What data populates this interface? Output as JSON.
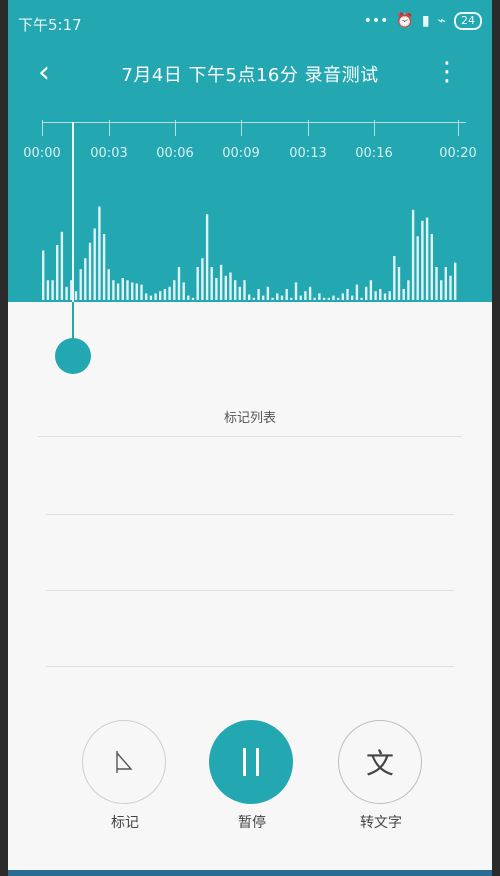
{
  "status_bar": {
    "time": "下午5:17",
    "right_text": "•••",
    "battery": "24"
  },
  "header": {
    "title": "7月4日  下午5点16分   录音测试"
  },
  "timeline": {
    "labels": [
      "00:00",
      "00:03",
      "00:06",
      "00:09",
      "00:13",
      "00:16",
      "00:20"
    ]
  },
  "waveform": {
    "amplitudes": [
      0.45,
      0.18,
      0.18,
      0.5,
      0.62,
      0.12,
      0.18,
      0.08,
      0.28,
      0.38,
      0.52,
      0.65,
      0.85,
      0.6,
      0.28,
      0.18,
      0.15,
      0.2,
      0.18,
      0.16,
      0.15,
      0.14,
      0.06,
      0.04,
      0.06,
      0.08,
      0.1,
      0.12,
      0.18,
      0.3,
      0.16,
      0.04,
      0.02,
      0.3,
      0.38,
      0.78,
      0.3,
      0.2,
      0.32,
      0.22,
      0.25,
      0.18,
      0.12,
      0.18,
      0.05,
      0.02,
      0.1,
      0.04,
      0.12,
      0.02,
      0.06,
      0.04,
      0.1,
      0.02,
      0.16,
      0.04,
      0.08,
      0.12,
      0.02,
      0.06,
      0.02,
      0.02,
      0.04,
      0.02,
      0.06,
      0.1,
      0.04,
      0.14,
      0.02,
      0.12,
      0.18,
      0.08,
      0.1,
      0.06,
      0.08,
      0.4,
      0.3,
      0.1,
      0.18,
      0.82,
      0.58,
      0.72,
      0.75,
      0.6,
      0.3,
      0.18,
      0.3,
      0.22,
      0.34
    ]
  },
  "markers": {
    "title": "标记列表"
  },
  "controls": {
    "mark_label": "标记",
    "pause_label": "暂停",
    "transcribe_label": "转文字",
    "transcribe_icon_text": "文"
  },
  "colors": {
    "accent": "#23a7b1",
    "background": "#f7f7f7"
  }
}
